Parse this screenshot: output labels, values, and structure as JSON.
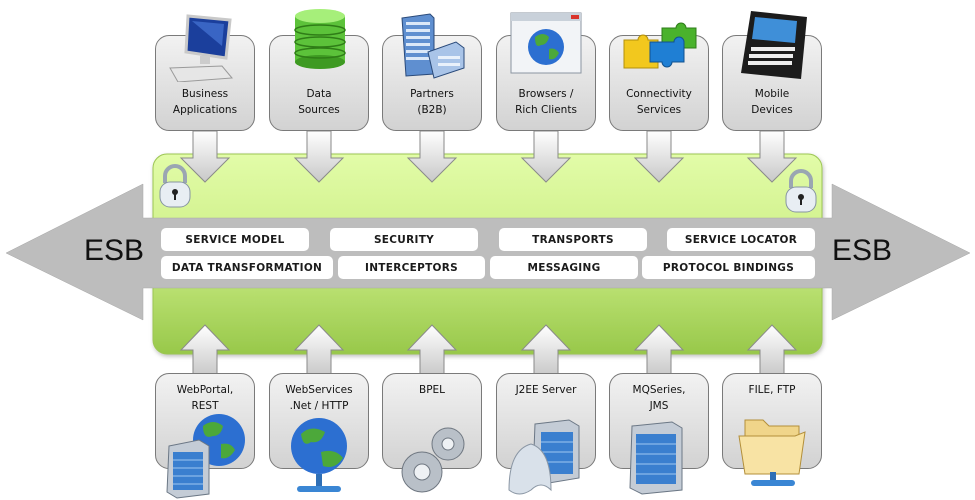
{
  "diagram": {
    "title": "ESB",
    "bus_label_left": "ESB",
    "bus_label_right": "ESB",
    "colors": {
      "bus_arrow": "#bebebe",
      "panel_green_top": "#ddfaa0",
      "panel_green_bottom": "#9ccb4e",
      "card_fill": "#e3e3e3",
      "chip_fill": "#ffffff"
    },
    "top_nodes": [
      {
        "label_line1": "Business",
        "label_line2": "Applications",
        "icon": "desktop-computer-icon"
      },
      {
        "label_line1": "Data",
        "label_line2": "Sources",
        "icon": "database-icon"
      },
      {
        "label_line1": "Partners",
        "label_line2": "(B2B)",
        "icon": "office-building-icon"
      },
      {
        "label_line1": "Browsers /",
        "label_line2": "Rich Clients",
        "icon": "browser-globe-icon"
      },
      {
        "label_line1": "Connectivity",
        "label_line2": "Services",
        "icon": "puzzle-pieces-icon"
      },
      {
        "label_line1": "Mobile",
        "label_line2": "Devices",
        "icon": "mobile-device-icon"
      }
    ],
    "capabilities_row1": [
      "SERVICE MODEL",
      "SECURITY",
      "TRANSPORTS",
      "SERVICE LOCATOR"
    ],
    "capabilities_row2": [
      "DATA TRANSFORMATION",
      "INTERCEPTORS",
      "MESSAGING",
      "PROTOCOL BINDINGS"
    ],
    "bottom_nodes": [
      {
        "label_line1": "WebPortal,",
        "label_line2": "REST",
        "icon": "server-globe-icon"
      },
      {
        "label_line1": "WebServices",
        "label_line2": ".Net / HTTP",
        "icon": "network-globe-icon"
      },
      {
        "label_line1": "BPEL",
        "label_line2": "",
        "icon": "gears-icon"
      },
      {
        "label_line1": "J2EE Server",
        "label_line2": "",
        "icon": "app-server-icon"
      },
      {
        "label_line1": "MQSeries,",
        "label_line2": "JMS",
        "icon": "server-icon"
      },
      {
        "label_line1": "FILE, FTP",
        "label_line2": "",
        "icon": "network-folder-icon"
      }
    ],
    "lock_icons": [
      "padlock-icon",
      "padlock-icon"
    ]
  }
}
